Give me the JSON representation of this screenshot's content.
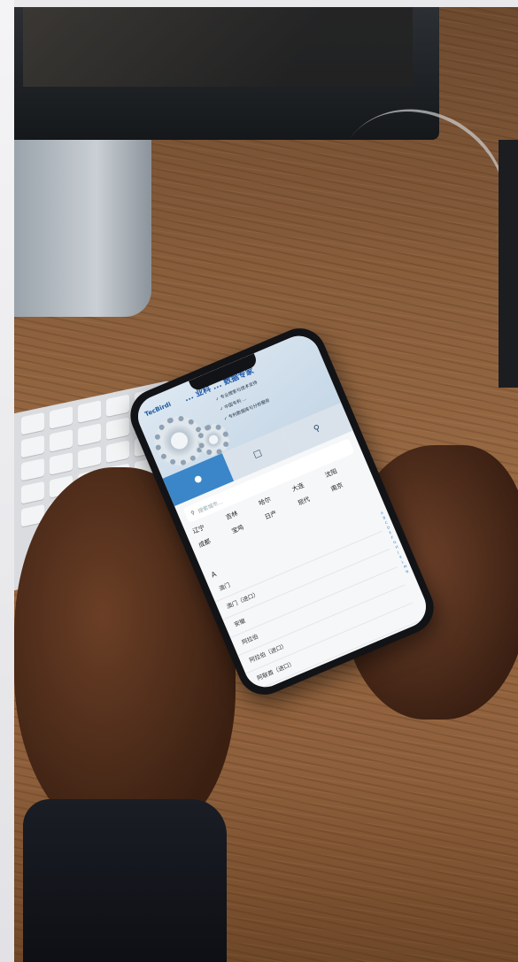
{
  "phone_screen": {
    "logo": "TecBirdi",
    "headline": "... 业科 ... 数据专家",
    "bullets": [
      "✓ 专业搜索与技术支持",
      "✓ 中国专利 ...",
      "✓ 专利数据库与分析服务"
    ],
    "tabs": [
      {
        "icon": "user-icon",
        "label": "",
        "active": true
      },
      {
        "icon": "document-icon",
        "label": ""
      },
      {
        "icon": "search-icon",
        "label": ""
      }
    ],
    "search_placeholder": "搜索城市...",
    "cities": [
      "辽宁",
      "吉林",
      "哈尔",
      "大连",
      "沈阳",
      "成都",
      "宝鸡",
      "日产",
      "现代",
      "南京"
    ],
    "section_letter": "A",
    "list": [
      "澳门",
      "澳门（进口）",
      "安徽",
      "阿拉伯",
      "阿拉伯（进口）",
      "阿联酋（进口）"
    ],
    "alphabet": [
      "A",
      "B",
      "C",
      "D",
      "E",
      "F",
      "G",
      "H",
      "J",
      "K",
      "L",
      "M",
      "N"
    ]
  }
}
